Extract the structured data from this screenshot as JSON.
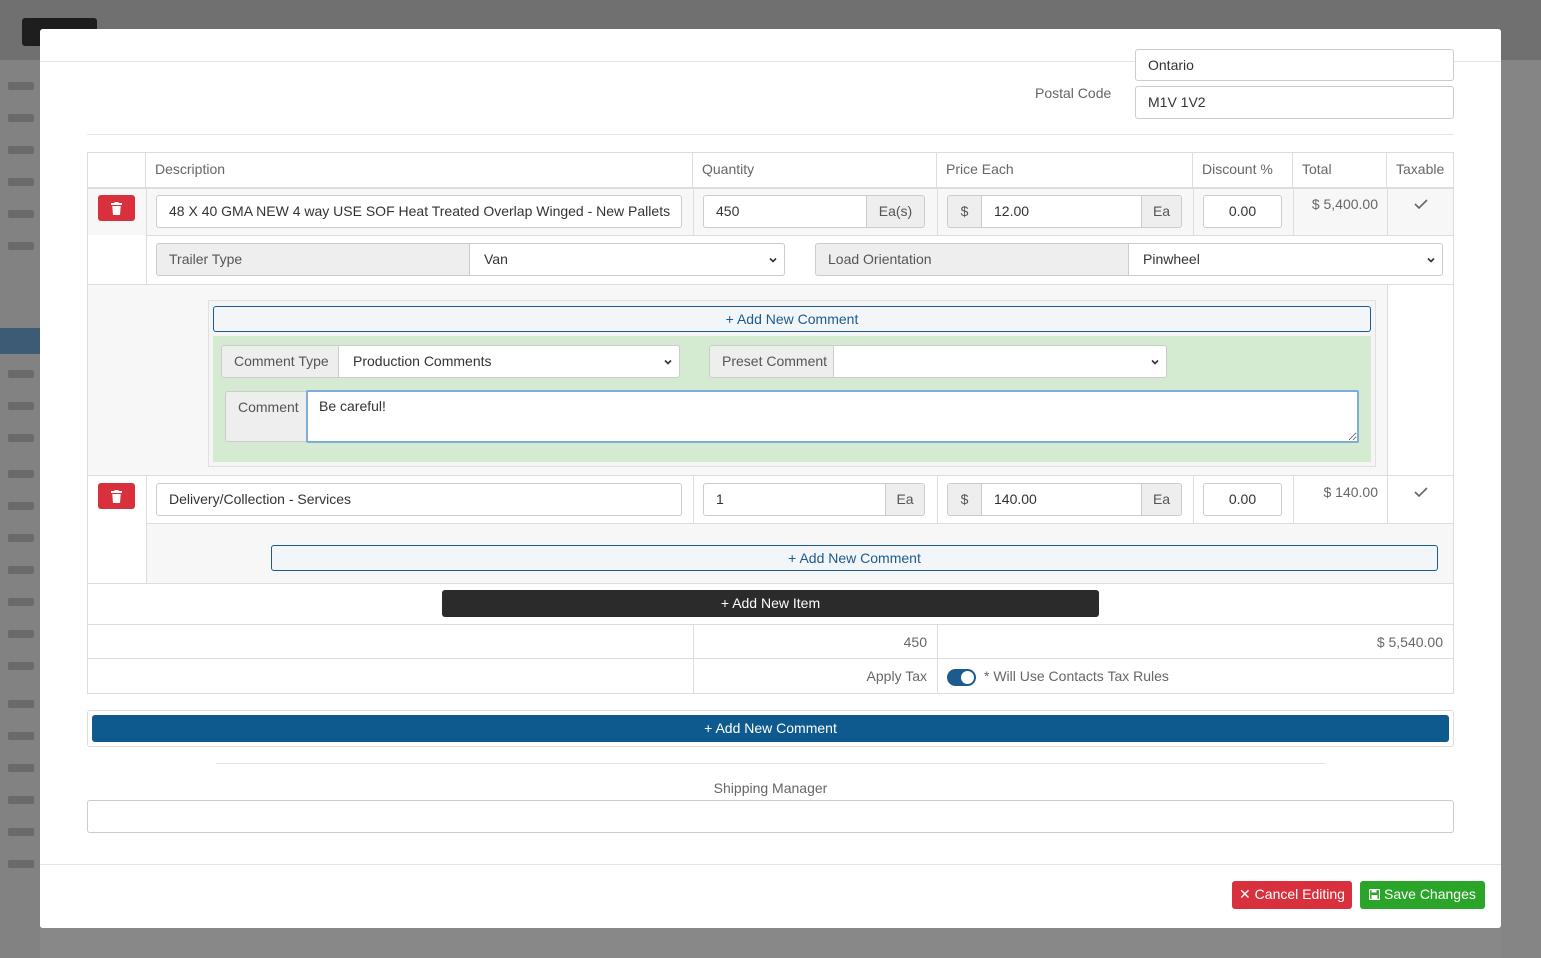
{
  "address": {
    "province_value": "Ontario",
    "postal_code_label": "Postal Code",
    "postal_code_value": "M1V 1V2"
  },
  "table": {
    "headers": [
      "Description",
      "Quantity",
      "Price Each",
      "Discount %",
      "Total",
      "Taxable"
    ],
    "items": [
      {
        "description": "48 X 40 GMA NEW 4 way USE SOF Heat Treated Overlap Winged - New Pallets",
        "quantity": "450",
        "quantity_unit": "Ea(s)",
        "currency": "$",
        "price": "12.00",
        "price_unit": "Ea",
        "discount": "0.00",
        "total": "$ 5,400.00"
      },
      {
        "description": "Delivery/Collection - Services",
        "quantity": "1",
        "quantity_unit": "Ea",
        "currency": "$",
        "price": "140.00",
        "price_unit": "Ea",
        "discount": "0.00",
        "total": "$ 140.00"
      }
    ],
    "trailer_type_label": "Trailer Type",
    "trailer_type_value": "Van",
    "load_orientation_label": "Load Orientation",
    "load_orientation_value": "Pinwheel",
    "add_comment_label": "Add New Comment",
    "comment_type_label": "Comment Type",
    "comment_type_value": "Production Comments",
    "preset_comment_label": "Preset Comment",
    "preset_comment_value": "",
    "comment_label": "Comment",
    "comment_value": "Be careful!",
    "add_item_label": "Add New Item",
    "total_quantity": "450",
    "grand_total": "$ 5,540.00",
    "apply_tax_label": "Apply Tax",
    "apply_tax_on": true,
    "tax_note": "* Will Use Contacts Tax Rules"
  },
  "main_add_comment_label": "Add New Comment",
  "shipping_manager_label": "Shipping Manager",
  "shipping_manager_value": "",
  "footer": {
    "cancel_label": "Cancel Editing",
    "save_label": "Save Changes"
  },
  "colors": {
    "danger": "#d9303e",
    "primary": "#0e5a8e",
    "success": "#2aa52a",
    "comment_bg": "#d4ebd1",
    "dark": "#2b2b2b"
  }
}
